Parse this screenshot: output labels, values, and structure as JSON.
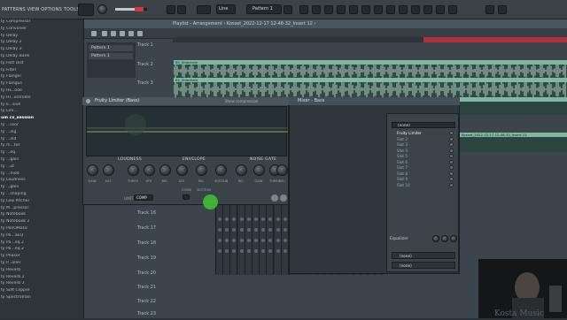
{
  "menu": {
    "text": "PATTERNS VIEW OPTIONS TOOLS HELP"
  },
  "topbar": {
    "mode_label": "Line",
    "pattern_label": "Pattern 1",
    "colors": {
      "bar": "#3a4246",
      "button": "#232a2e"
    }
  },
  "browser": {
    "items": [
      "ty Compressor",
      "ty Convolver",
      "ty Delay",
      "ty Delay 2",
      "ty Delay 3",
      "ty Delay Bank",
      "ty Fast Dist",
      "ty Filter",
      "ty Flanger",
      "ty Flangus",
      "ty HE..ode",
      "ty HT..ontroller",
      "ty k...sive",
      "ty Lim...",
      "um cx_session",
      "ty ...ssor",
      "ty ...ing",
      "ty ...ind",
      "ty m...ter",
      "ty ...eq",
      "ty ...gain",
      "ty ...ut",
      "ty ...mod",
      "ty Loudness",
      "ty ...gain",
      "ty ...shaping",
      "ty Low Pitcher",
      "ty M...pressor",
      "ty Notebook",
      "ty Notebook 2",
      "ty PanOMatic",
      "ty Pa...aEQ",
      "ty Pa...eq 2",
      "ty Pa...eq 2",
      "ty Phaser",
      "ty P...oller",
      "ty Reverb",
      "ty Reverb 2",
      "ty Reverb 3",
      "ty Soft Clipper",
      "ty Spectroman"
    ],
    "highlighted_index": 14
  },
  "playlist": {
    "title": "Playlist - Arrangement › Kosset_2022-12-17 12-46-32_Insert 12 ›",
    "patterns": [
      "Pattern 1",
      "Pattern 1"
    ],
    "tracks": [
      "Track 1",
      "Track 2",
      "Track 3",
      "Track 16",
      "Track 17",
      "Track 18",
      "Track 19",
      "Track 20",
      "Track 21",
      "Track 22",
      "Track 23"
    ],
    "clip_labels": {
      "track2": "85_Sidechain",
      "track3": "85_Sidechain",
      "track4": "Kosset_2022-12-17 12-46-32_Insert 12",
      "track5": "Kosset_2022-12-17 12-46-32_Insert 12"
    },
    "colors": {
      "clip": "#7fb8a4",
      "ruler_loop": "#b0303a"
    }
  },
  "limiter": {
    "title": "Fruity Limiter (Bass)",
    "subtitle": "Show compression",
    "sections": [
      "LOUDNESS",
      "ENVELOPE",
      "NOISE GATE"
    ],
    "knobs": [
      "GAIN",
      "SAT",
      "THRES",
      "ATK",
      "REL",
      "ATK",
      "REL",
      "SUSTAIN",
      "REL",
      "GAIN",
      "THRES",
      "REL"
    ],
    "bottom": {
      "mode_label": "LIMIT",
      "mode_value": "COMP",
      "link_label": "COMB",
      "section_label": "SECTION"
    }
  },
  "mixer": {
    "title": "Mixer - Bass",
    "selected_insert": "(none)",
    "slots": [
      "Fruity Limiter",
      "Slot 2",
      "Slot 3",
      "Slot 4",
      "Slot 5",
      "Slot 6",
      "Slot 7",
      "Slot 8",
      "Slot 9",
      "Slot 10"
    ],
    "active_slot": 0,
    "eq_label": "Equalizer",
    "output_rows": [
      "(none)",
      "(none)"
    ]
  },
  "webcam": {
    "label": "Kosta Music"
  }
}
